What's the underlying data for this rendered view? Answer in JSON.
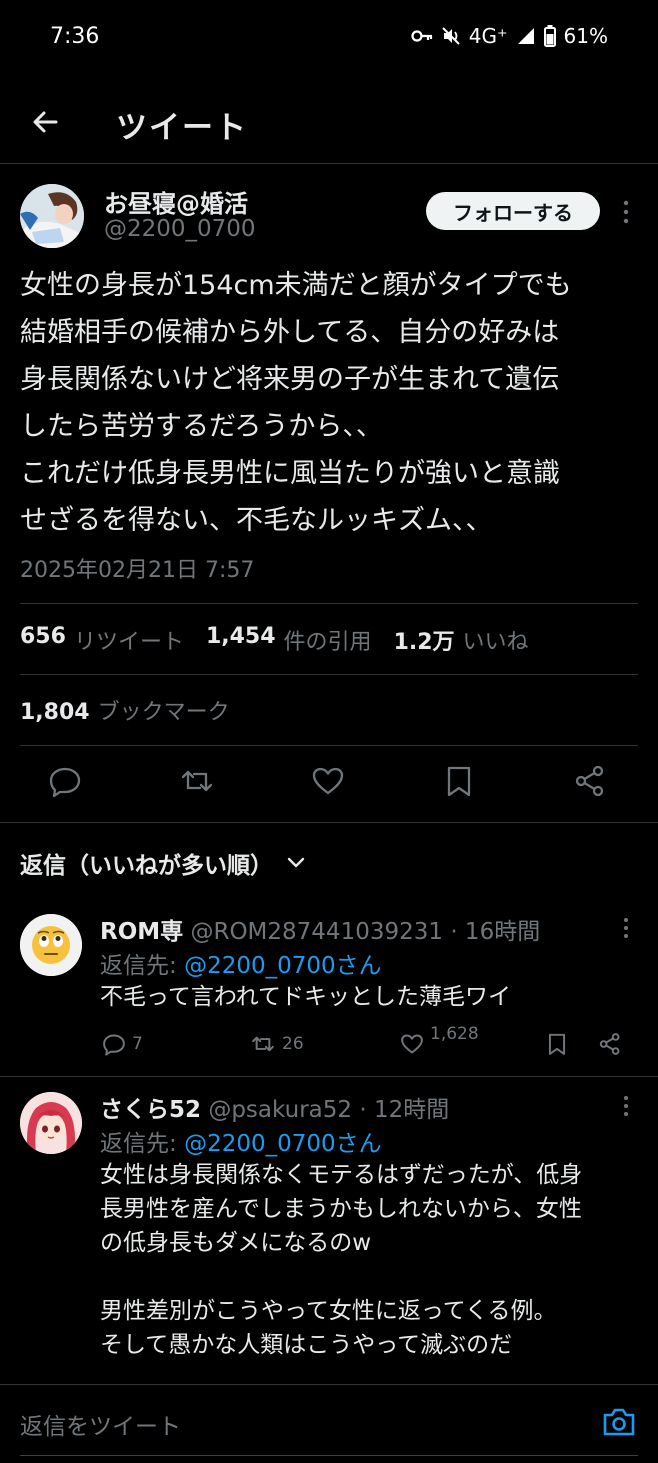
{
  "status_bar": {
    "time": "7:36",
    "network": "4G⁺",
    "battery": "61%"
  },
  "header": {
    "title": "ツイート"
  },
  "tweet": {
    "author_name": "お昼寝@婚活",
    "author_handle": "@2200_0700",
    "follow_label": "フォローする",
    "text": "女性の身長が154cm未満だと顔がタイプでも\n結婚相手の候補から外してる、自分の好みは\n身長関係ないけど将来男の子が生まれて遺伝\nしたら苦労するだろうから、、\nこれだけ低身長男性に風当たりが強いと意識\nせざるを得ない、不毛なルッキズム、、",
    "timestamp": "2025年02月21日 7:57",
    "stats": {
      "retweets": "656",
      "retweets_label": "リツイート",
      "quotes": "1,454",
      "quotes_label": "件の引用",
      "likes": "1.2万",
      "likes_label": "いいね",
      "bookmarks": "1,804",
      "bookmarks_label": "ブックマーク"
    }
  },
  "sort": {
    "label": "返信（いいねが多い順）"
  },
  "replies": [
    {
      "name": "ROM専",
      "handle": "@ROM287441039231",
      "time": "· 16時間",
      "reply_to_prefix": "返信先:",
      "reply_to": "@2200_0700さん",
      "text": "不毛って言われてドキッとした薄毛ワイ",
      "replies": "7",
      "retweets": "26",
      "likes": "1,628"
    },
    {
      "name": "さくら52",
      "handle": "@psakura52",
      "time": "· 12時間",
      "reply_to_prefix": "返信先:",
      "reply_to": "@2200_0700さん",
      "text": "女性は身長関係なくモテるはずだったが、低身\n長男性を産んでしまうかもしれないから、女性\nの低身長もダメになるのw\n\n男性差別がこうやって女性に返ってくる例。\nそして愚かな人類はこうやって滅ぶのだ"
    }
  ],
  "compose": {
    "placeholder": "返信をツイート"
  },
  "colors": {
    "background": "#000000",
    "text": "#e7e9ea",
    "secondary": "#71767b",
    "accent": "#1d9bf0",
    "divider": "#2f3336"
  },
  "icons": [
    "back-arrow-icon",
    "more-icon",
    "reply-icon",
    "retweet-icon",
    "like-icon",
    "bookmark-icon",
    "share-icon",
    "chevron-down-icon",
    "camera-icon",
    "key-icon",
    "mute-icon",
    "signal-icon",
    "battery-icon"
  ]
}
